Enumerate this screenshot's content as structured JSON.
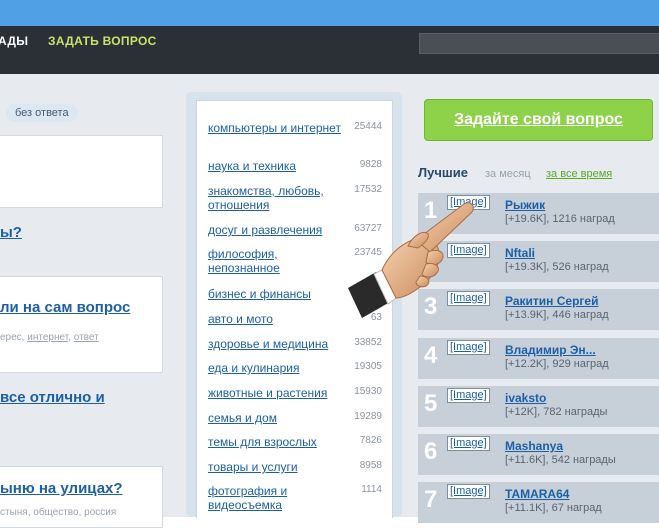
{
  "nav": {
    "awards_label": "АДЫ",
    "ask_label": "ЗАДАТЬ ВОПРОС"
  },
  "left": {
    "filter_pill": "без ответа",
    "questions": [
      {
        "title": "ы?",
        "tags": ""
      },
      {
        "title": "ли на сам вопрос",
        "tags_prefix": "ерес, ",
        "tag1": "интернет",
        "tag_sep": ", ",
        "tag2": "ответ"
      },
      {
        "title": "все отлично и",
        "tags": ""
      },
      {
        "title": "ыню на улицах?",
        "tags": "стыня, общество, россия"
      }
    ]
  },
  "categories": [
    {
      "name": "компьютеры и интернет",
      "count": "25444"
    },
    {
      "name": "наука и техника",
      "count": "9828"
    },
    {
      "name": "знакомства, любовь, отношения",
      "count": "17532"
    },
    {
      "name": "досуг и развлечения",
      "count": "63727"
    },
    {
      "name": "философия, непознанное",
      "count": "23745"
    },
    {
      "name": "бизнес и финансы",
      "count": ""
    },
    {
      "name": "авто и мото",
      "count": "63"
    },
    {
      "name": "здоровье и медицина",
      "count": "33852"
    },
    {
      "name": "еда и кулинария",
      "count": "19305"
    },
    {
      "name": "животные и растения",
      "count": "15930"
    },
    {
      "name": "семья и дом",
      "count": "19289"
    },
    {
      "name": "темы для взрослых",
      "count": "7826"
    },
    {
      "name": "товары и услуги",
      "count": "8958"
    },
    {
      "name": "фотография и видеосъемка",
      "count": "1114"
    }
  ],
  "right": {
    "ask_button": "Задайте свой вопрос",
    "best_title": "Лучшие",
    "per_month": "за месяц",
    "all_time": "за все время",
    "leaders": [
      {
        "rank": "1",
        "avatar": "[Image]",
        "name": "Рыжик",
        "stats": "[+19.6K], 1216 наград"
      },
      {
        "rank": "2",
        "avatar": "[Image]",
        "name": "Nftali",
        "stats": "[+19.3K], 526 наград"
      },
      {
        "rank": "3",
        "avatar": "[Image]",
        "name": "Ракитин Сергей",
        "stats": "[+13.9K], 446 наград"
      },
      {
        "rank": "4",
        "avatar": "[Image]",
        "name": "Владимир Эн...",
        "stats": "[+12.2K], 929 наград"
      },
      {
        "rank": "5",
        "avatar": "[Image]",
        "name": "ivaksto",
        "stats": "[+12K], 782 награды"
      },
      {
        "rank": "6",
        "avatar": "[Image]",
        "name": "Mashanya",
        "stats": "[+11.6K], 542 награды"
      },
      {
        "rank": "7",
        "avatar": "[Image]",
        "name": "TAMARA64",
        "stats": "[+11.1K], 67 наград"
      }
    ]
  },
  "colors": {
    "nav_bg": "#2b3037",
    "link": "#1d5fa6",
    "ask_button": "#8ed24a",
    "accent_green": "#58a82a"
  },
  "icons": [
    "pointing-hand-icon"
  ]
}
